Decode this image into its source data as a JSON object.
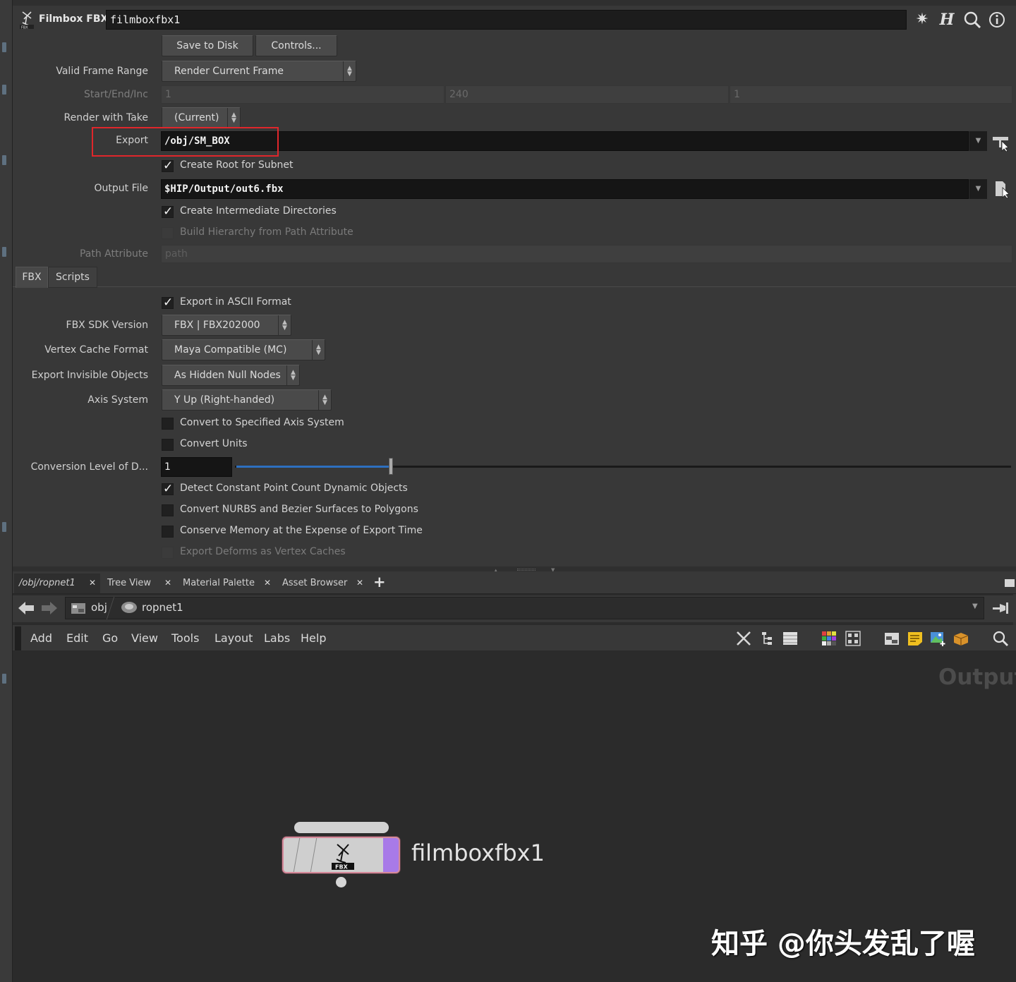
{
  "title": {
    "node_type": "Filmbox FBX",
    "node_name": "filmboxfbx1"
  },
  "buttons": {
    "save_to_disk": "Save to Disk",
    "controls": "Controls..."
  },
  "params": {
    "valid_frame_range": {
      "label": "Valid Frame Range",
      "value": "Render Current Frame"
    },
    "start_end_inc": {
      "label": "Start/End/Inc",
      "start": "1",
      "end": "240",
      "inc": "1"
    },
    "render_with_take": {
      "label": "Render with Take",
      "value": "(Current)"
    },
    "export": {
      "label": "Export",
      "value": "/obj/SM_BOX"
    },
    "create_root": {
      "label": "Create Root for Subnet",
      "checked": true
    },
    "output_file": {
      "label": "Output File",
      "value": "$HIP/Output/out6.fbx"
    },
    "create_dirs": {
      "label": "Create Intermediate Directories",
      "checked": true
    },
    "build_hierarchy": {
      "label": "Build Hierarchy from Path Attribute",
      "checked": false
    },
    "path_attribute": {
      "label": "Path Attribute",
      "placeholder": "path"
    }
  },
  "tabs": [
    "FBX",
    "Scripts"
  ],
  "fbx": {
    "export_ascii": {
      "label": "Export in ASCII Format",
      "checked": true
    },
    "sdk_version": {
      "label": "FBX SDK Version",
      "value": "FBX | FBX202000"
    },
    "vertex_cache": {
      "label": "Vertex Cache Format",
      "value": "Maya Compatible (MC)"
    },
    "invisible_objects": {
      "label": "Export Invisible Objects",
      "value": "As Hidden Null Nodes"
    },
    "axis_system": {
      "label": "Axis System",
      "value": "Y Up (Right-handed)"
    },
    "convert_axis": {
      "label": "Convert to Specified Axis System",
      "checked": false
    },
    "convert_units": {
      "label": "Convert Units",
      "checked": false
    },
    "conversion_level": {
      "label": "Conversion Level of D...",
      "value": "1",
      "slider_fraction": 0.2
    },
    "detect_constant": {
      "label": "Detect Constant Point Count Dynamic Objects",
      "checked": true
    },
    "convert_nurbs": {
      "label": "Convert NURBS and Bezier Surfaces to Polygons",
      "checked": false
    },
    "conserve_memory": {
      "label": "Conserve Memory at the Expense of Export Time",
      "checked": false
    },
    "export_deforms": {
      "label": "Export Deforms as Vertex Caches",
      "checked": false
    }
  },
  "pane_tabs": [
    "/obj/ropnet1",
    "Tree View",
    "Material Palette",
    "Asset Browser"
  ],
  "path": {
    "obj": "obj",
    "ropnet": "ropnet1"
  },
  "menubar": [
    "Add",
    "Edit",
    "Go",
    "View",
    "Tools",
    "Layout",
    "Labs",
    "Help"
  ],
  "network": {
    "watermark": "Output",
    "node_label": "filmboxfbx1",
    "node_icon_text": "FBX"
  },
  "credit": "知乎 @你头发乱了喔",
  "colors": {
    "highlight": "#e0262b",
    "node_flag": "#a87ae8",
    "slider": "#2d6fbf"
  }
}
